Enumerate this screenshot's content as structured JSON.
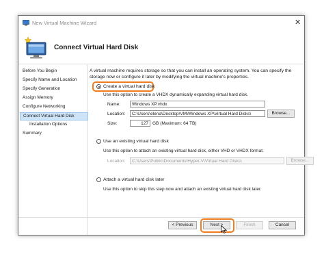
{
  "window": {
    "title": "New Virtual Machine Wizard",
    "close_glyph": "✕",
    "header_title": "Connect Virtual Hard Disk"
  },
  "nav": {
    "items": [
      {
        "label": "Before You Begin"
      },
      {
        "label": "Specify Name and Location"
      },
      {
        "label": "Specify Generation"
      },
      {
        "label": "Assign Memory"
      },
      {
        "label": "Configure Networking"
      },
      {
        "label": "Connect Virtual Hard Disk"
      },
      {
        "label": "Installation Options"
      },
      {
        "label": "Summary"
      }
    ]
  },
  "content": {
    "intro": "A virtual machine requires storage so that you can install an operating system. You can specify the storage now or configure it later by modifying the virtual machine's properties.",
    "create": {
      "label": "Create a virtual hard disk",
      "desc": "Use this option to create a VHDX dynamically expanding virtual hard disk.",
      "name_label": "Name:",
      "name_value": "Windows XP.vhdx",
      "location_label": "Location:",
      "location_value": "C:\\Users\\elena\\Desktop\\VM\\Windows XP\\Virtual Hard Disks\\",
      "browse_label": "Browse...",
      "size_label": "Size:",
      "size_value": "127",
      "size_suffix": "GB (Maximum: 64 TB)"
    },
    "existing": {
      "label": "Use an existing virtual hard disk",
      "desc": "Use this option to attach an existing virtual hard disk, either VHD or VHDX format.",
      "location_label": "Location:",
      "location_value": "C:\\Users\\Public\\Documents\\Hyper-V\\Virtual Hard Disks\\",
      "browse_label": "Browse..."
    },
    "later": {
      "label": "Attach a virtual hard disk later",
      "desc": "Use this option to skip this step now and attach an existing virtual hard disk later."
    }
  },
  "footer": {
    "previous_label": "< Previous",
    "next_label": "Next >",
    "finish_label": "Finish",
    "cancel_label": "Cancel"
  },
  "colors": {
    "highlight": "#f07c1e",
    "selected_bg": "#cde3f7"
  }
}
